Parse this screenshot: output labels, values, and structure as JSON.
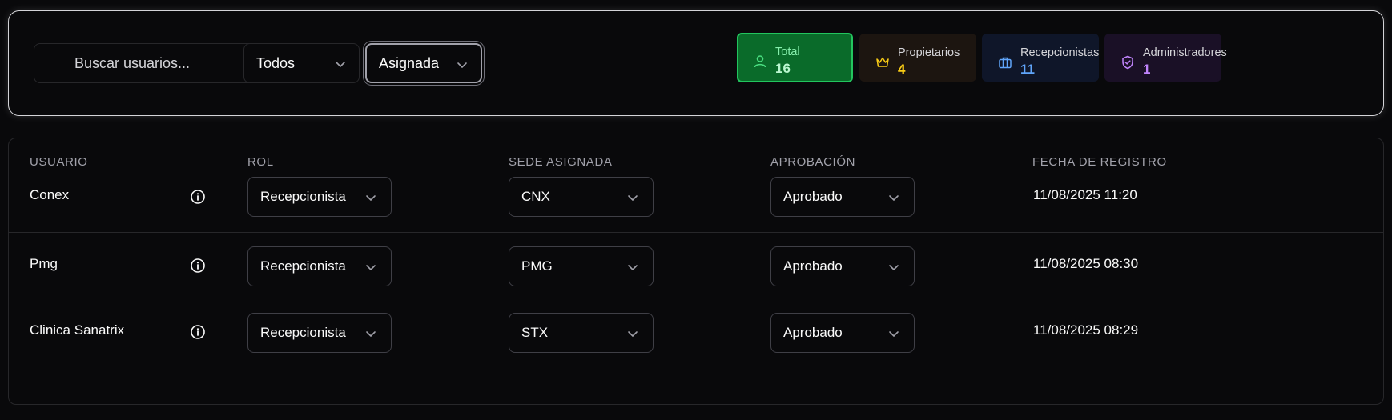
{
  "filters": {
    "search_placeholder": "Buscar usuarios...",
    "role_filter": "Todos",
    "site_filter": "Asignada"
  },
  "stats": [
    {
      "label": "Total",
      "value": "16",
      "icon": "user-icon",
      "bg": "#0a6b2a",
      "border": "#22c55e",
      "label_color": "#86efac",
      "value_color": "#bbf7d0",
      "icon_color": "#4ade80"
    },
    {
      "label": "Propietarios",
      "value": "4",
      "icon": "crown-icon",
      "bg": "#1c1510",
      "border": "#1c1510",
      "label_color": "#d4d4d8",
      "value_color": "#facc15",
      "icon_color": "#facc15"
    },
    {
      "label": "Recepcionistas",
      "value": "11",
      "icon": "briefcase-icon",
      "bg": "#0f1629",
      "border": "#0f1629",
      "label_color": "#d4d4d8",
      "value_color": "#60a5fa",
      "icon_color": "#60a5fa"
    },
    {
      "label": "Administradores",
      "value": "1",
      "icon": "shield-icon",
      "bg": "#1a1026",
      "border": "#1a1026",
      "label_color": "#d4d4d8",
      "value_color": "#c084fc",
      "icon_color": "#c084fc"
    }
  ],
  "table": {
    "headers": [
      "USUARIO",
      "ROL",
      "SEDE ASIGNADA",
      "APROBACIÓN",
      "FECHA DE REGISTRO"
    ],
    "rows": [
      {
        "user": "Conex",
        "role": "Recepcionista",
        "site": "CNX",
        "approval": "Aprobado",
        "date": "11/08/2025 11:20"
      },
      {
        "user": "Pmg",
        "role": "Recepcionista",
        "site": "PMG",
        "approval": "Aprobado",
        "date": "11/08/2025 08:30"
      },
      {
        "user": "Clinica Sanatrix",
        "role": "Recepcionista",
        "site": "STX",
        "approval": "Aprobado",
        "date": "11/08/2025 08:29"
      }
    ]
  }
}
